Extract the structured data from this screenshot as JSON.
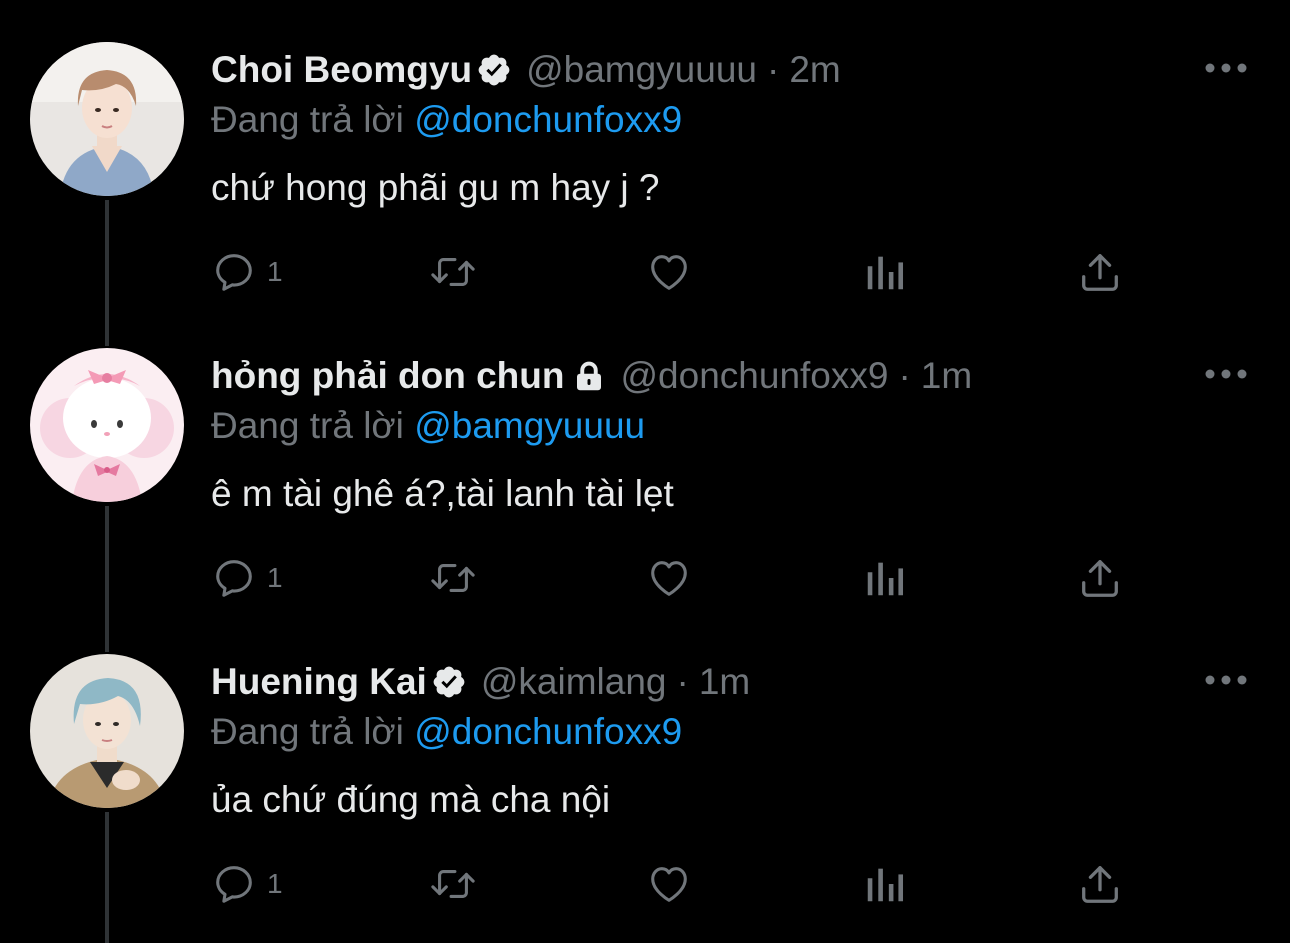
{
  "reply_prefix": "Đang trả lời",
  "tweets": [
    {
      "name": "Choi Beomgyu",
      "badge": "verified-badge-icon",
      "handle": "@bamgyuuuu",
      "separator": "·",
      "time": "2m",
      "reply_to": "@donchunfoxx9",
      "text": "chứ hong phãi gu m hay j ?",
      "reply_count": "1"
    },
    {
      "name": "hỏng phải don chun",
      "badge": "lock-icon",
      "handle": "@donchunfoxx9",
      "separator": "·",
      "time": "1m",
      "reply_to": "@bamgyuuuu",
      "text": "ê m tài ghê á?,tài lanh tài lẹt",
      "reply_count": "1"
    },
    {
      "name": "Huening Kai",
      "badge": "verified-badge-icon",
      "handle": "@kaimlang",
      "separator": "·",
      "time": "1m",
      "reply_to": "@donchunfoxx9",
      "text": "ủa chứ đúng mà cha nội",
      "reply_count": "1"
    }
  ],
  "colors": {
    "background": "#000000",
    "primary_text": "#e7e9ea",
    "secondary_text": "#71767b",
    "link": "#1d9bf0",
    "thread_line": "#2f3336"
  }
}
